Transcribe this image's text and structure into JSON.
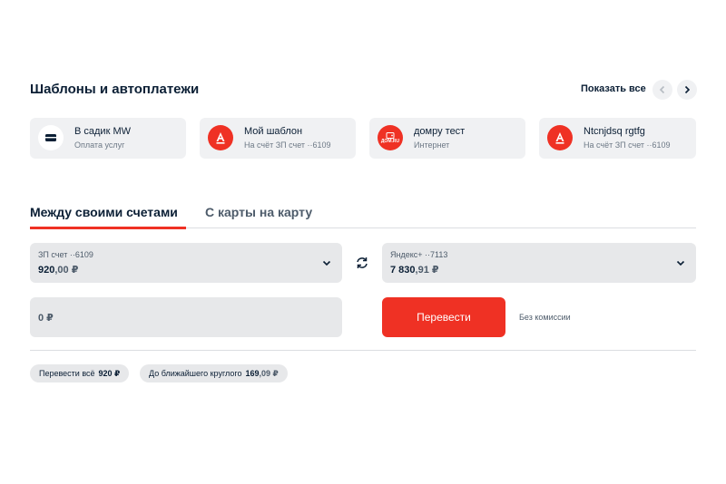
{
  "templates_section": {
    "title": "Шаблоны и автоплатежи",
    "show_all": "Показать все",
    "cards": [
      {
        "title": "В садик MW",
        "subtitle": "Оплата услуг",
        "icon": "wallet-icon"
      },
      {
        "title": "Мой шаблон",
        "subtitle": "На счёт ЗП счет ··6109",
        "icon": "alfa-bank-logo"
      },
      {
        "title": "домру тест",
        "subtitle": "Интернет",
        "icon": "domru-logo",
        "logo_text": "ДОМ.RU"
      },
      {
        "title": "Ntcnjdsq rgtfg",
        "subtitle": "На счёт ЗП счет ··6109",
        "icon": "alfa-bank-logo"
      }
    ]
  },
  "tabs": [
    {
      "label": "Между своими счетами",
      "active": true
    },
    {
      "label": "С карты на карту",
      "active": false
    }
  ],
  "from_account": {
    "name": "ЗП счет ··6109",
    "balance_main": "920",
    "balance_frac": ",00 ₽"
  },
  "to_account": {
    "name": "Яндекс+ ··7113",
    "balance_main": "7 830",
    "balance_frac": ",91 ₽"
  },
  "amount": {
    "value": "0 ₽"
  },
  "transfer_button": "Перевести",
  "fee_note": "Без комиссии",
  "chips": [
    {
      "label": "Перевести всё",
      "amount_main": "920 ₽",
      "amount_frac": ""
    },
    {
      "label": "До ближайшего круглого",
      "amount_main": "169",
      "amount_frac": ",09 ₽"
    }
  ],
  "colors": {
    "accent": "#ef3124",
    "text": "#0b1f35",
    "muted": "#6d7986",
    "field_bg": "#e7e8ea"
  }
}
